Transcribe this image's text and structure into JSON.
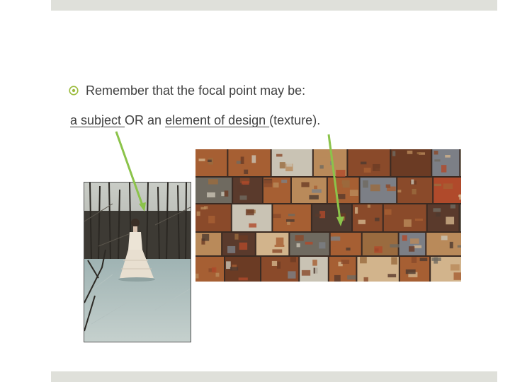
{
  "slide": {
    "bullet": {
      "icon": "target-circle-icon",
      "text": "Remember that the focal point may be:"
    },
    "subline": {
      "part1": "a subject ",
      "part2": "OR an ",
      "part3": "element of design ",
      "part4": "(texture)."
    },
    "images": [
      {
        "name": "woman-in-white-dress-on-ice-photo"
      },
      {
        "name": "crushed-metal-cubes-texture-photo"
      }
    ],
    "colors": {
      "accent_bar": "#dfe0da",
      "bullet_icon": "#9bbb3c",
      "arrow": "#8bc34a",
      "text": "#404040"
    }
  }
}
